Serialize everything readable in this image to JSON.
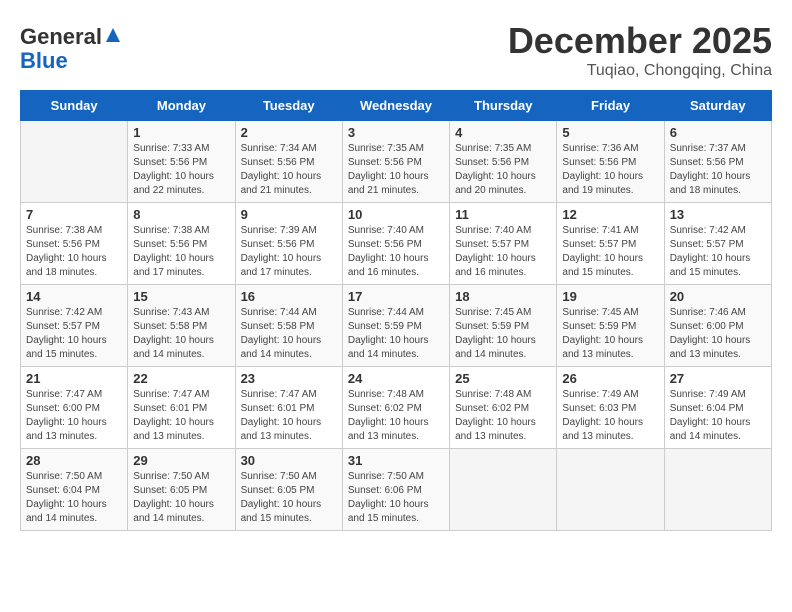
{
  "logo": {
    "general": "General",
    "blue": "Blue"
  },
  "title": "December 2025",
  "subtitle": "Tuqiao, Chongqing, China",
  "days_of_week": [
    "Sunday",
    "Monday",
    "Tuesday",
    "Wednesday",
    "Thursday",
    "Friday",
    "Saturday"
  ],
  "weeks": [
    [
      {
        "day": "",
        "sunrise": "",
        "sunset": "",
        "daylight": ""
      },
      {
        "day": "1",
        "sunrise": "Sunrise: 7:33 AM",
        "sunset": "Sunset: 5:56 PM",
        "daylight": "Daylight: 10 hours and 22 minutes."
      },
      {
        "day": "2",
        "sunrise": "Sunrise: 7:34 AM",
        "sunset": "Sunset: 5:56 PM",
        "daylight": "Daylight: 10 hours and 21 minutes."
      },
      {
        "day": "3",
        "sunrise": "Sunrise: 7:35 AM",
        "sunset": "Sunset: 5:56 PM",
        "daylight": "Daylight: 10 hours and 21 minutes."
      },
      {
        "day": "4",
        "sunrise": "Sunrise: 7:35 AM",
        "sunset": "Sunset: 5:56 PM",
        "daylight": "Daylight: 10 hours and 20 minutes."
      },
      {
        "day": "5",
        "sunrise": "Sunrise: 7:36 AM",
        "sunset": "Sunset: 5:56 PM",
        "daylight": "Daylight: 10 hours and 19 minutes."
      },
      {
        "day": "6",
        "sunrise": "Sunrise: 7:37 AM",
        "sunset": "Sunset: 5:56 PM",
        "daylight": "Daylight: 10 hours and 18 minutes."
      }
    ],
    [
      {
        "day": "7",
        "sunrise": "Sunrise: 7:38 AM",
        "sunset": "Sunset: 5:56 PM",
        "daylight": "Daylight: 10 hours and 18 minutes."
      },
      {
        "day": "8",
        "sunrise": "Sunrise: 7:38 AM",
        "sunset": "Sunset: 5:56 PM",
        "daylight": "Daylight: 10 hours and 17 minutes."
      },
      {
        "day": "9",
        "sunrise": "Sunrise: 7:39 AM",
        "sunset": "Sunset: 5:56 PM",
        "daylight": "Daylight: 10 hours and 17 minutes."
      },
      {
        "day": "10",
        "sunrise": "Sunrise: 7:40 AM",
        "sunset": "Sunset: 5:56 PM",
        "daylight": "Daylight: 10 hours and 16 minutes."
      },
      {
        "day": "11",
        "sunrise": "Sunrise: 7:40 AM",
        "sunset": "Sunset: 5:57 PM",
        "daylight": "Daylight: 10 hours and 16 minutes."
      },
      {
        "day": "12",
        "sunrise": "Sunrise: 7:41 AM",
        "sunset": "Sunset: 5:57 PM",
        "daylight": "Daylight: 10 hours and 15 minutes."
      },
      {
        "day": "13",
        "sunrise": "Sunrise: 7:42 AM",
        "sunset": "Sunset: 5:57 PM",
        "daylight": "Daylight: 10 hours and 15 minutes."
      }
    ],
    [
      {
        "day": "14",
        "sunrise": "Sunrise: 7:42 AM",
        "sunset": "Sunset: 5:57 PM",
        "daylight": "Daylight: 10 hours and 15 minutes."
      },
      {
        "day": "15",
        "sunrise": "Sunrise: 7:43 AM",
        "sunset": "Sunset: 5:58 PM",
        "daylight": "Daylight: 10 hours and 14 minutes."
      },
      {
        "day": "16",
        "sunrise": "Sunrise: 7:44 AM",
        "sunset": "Sunset: 5:58 PM",
        "daylight": "Daylight: 10 hours and 14 minutes."
      },
      {
        "day": "17",
        "sunrise": "Sunrise: 7:44 AM",
        "sunset": "Sunset: 5:59 PM",
        "daylight": "Daylight: 10 hours and 14 minutes."
      },
      {
        "day": "18",
        "sunrise": "Sunrise: 7:45 AM",
        "sunset": "Sunset: 5:59 PM",
        "daylight": "Daylight: 10 hours and 14 minutes."
      },
      {
        "day": "19",
        "sunrise": "Sunrise: 7:45 AM",
        "sunset": "Sunset: 5:59 PM",
        "daylight": "Daylight: 10 hours and 13 minutes."
      },
      {
        "day": "20",
        "sunrise": "Sunrise: 7:46 AM",
        "sunset": "Sunset: 6:00 PM",
        "daylight": "Daylight: 10 hours and 13 minutes."
      }
    ],
    [
      {
        "day": "21",
        "sunrise": "Sunrise: 7:47 AM",
        "sunset": "Sunset: 6:00 PM",
        "daylight": "Daylight: 10 hours and 13 minutes."
      },
      {
        "day": "22",
        "sunrise": "Sunrise: 7:47 AM",
        "sunset": "Sunset: 6:01 PM",
        "daylight": "Daylight: 10 hours and 13 minutes."
      },
      {
        "day": "23",
        "sunrise": "Sunrise: 7:47 AM",
        "sunset": "Sunset: 6:01 PM",
        "daylight": "Daylight: 10 hours and 13 minutes."
      },
      {
        "day": "24",
        "sunrise": "Sunrise: 7:48 AM",
        "sunset": "Sunset: 6:02 PM",
        "daylight": "Daylight: 10 hours and 13 minutes."
      },
      {
        "day": "25",
        "sunrise": "Sunrise: 7:48 AM",
        "sunset": "Sunset: 6:02 PM",
        "daylight": "Daylight: 10 hours and 13 minutes."
      },
      {
        "day": "26",
        "sunrise": "Sunrise: 7:49 AM",
        "sunset": "Sunset: 6:03 PM",
        "daylight": "Daylight: 10 hours and 13 minutes."
      },
      {
        "day": "27",
        "sunrise": "Sunrise: 7:49 AM",
        "sunset": "Sunset: 6:04 PM",
        "daylight": "Daylight: 10 hours and 14 minutes."
      }
    ],
    [
      {
        "day": "28",
        "sunrise": "Sunrise: 7:50 AM",
        "sunset": "Sunset: 6:04 PM",
        "daylight": "Daylight: 10 hours and 14 minutes."
      },
      {
        "day": "29",
        "sunrise": "Sunrise: 7:50 AM",
        "sunset": "Sunset: 6:05 PM",
        "daylight": "Daylight: 10 hours and 14 minutes."
      },
      {
        "day": "30",
        "sunrise": "Sunrise: 7:50 AM",
        "sunset": "Sunset: 6:05 PM",
        "daylight": "Daylight: 10 hours and 15 minutes."
      },
      {
        "day": "31",
        "sunrise": "Sunrise: 7:50 AM",
        "sunset": "Sunset: 6:06 PM",
        "daylight": "Daylight: 10 hours and 15 minutes."
      },
      {
        "day": "",
        "sunrise": "",
        "sunset": "",
        "daylight": ""
      },
      {
        "day": "",
        "sunrise": "",
        "sunset": "",
        "daylight": ""
      },
      {
        "day": "",
        "sunrise": "",
        "sunset": "",
        "daylight": ""
      }
    ]
  ]
}
